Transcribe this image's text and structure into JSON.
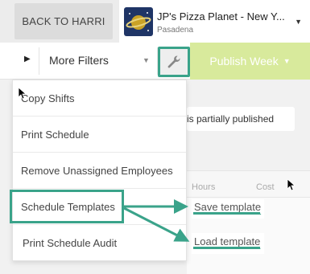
{
  "header": {
    "back_button": "BACK TO HARRI",
    "store_name": "JP's Pizza Planet - New Y...",
    "store_location": "Pasadena"
  },
  "toolbar": {
    "more_filters": "More Filters",
    "publish_week": "Publish Week"
  },
  "background": {
    "notice": "is partially published",
    "col_hours": "Hours",
    "col_cost": "Cost"
  },
  "menu": {
    "items": [
      {
        "label": "Copy Shifts"
      },
      {
        "label": "Print Schedule"
      },
      {
        "label": "Remove Unassigned Employees"
      },
      {
        "label": "Schedule Templates"
      },
      {
        "label": "Print Schedule Audit"
      }
    ]
  },
  "submenu": {
    "save": "Save template",
    "load": "Load template"
  },
  "colors": {
    "highlight": "#3aa38a",
    "publish_bg": "#d8ea9c",
    "logo_bg": "#1f3566"
  }
}
